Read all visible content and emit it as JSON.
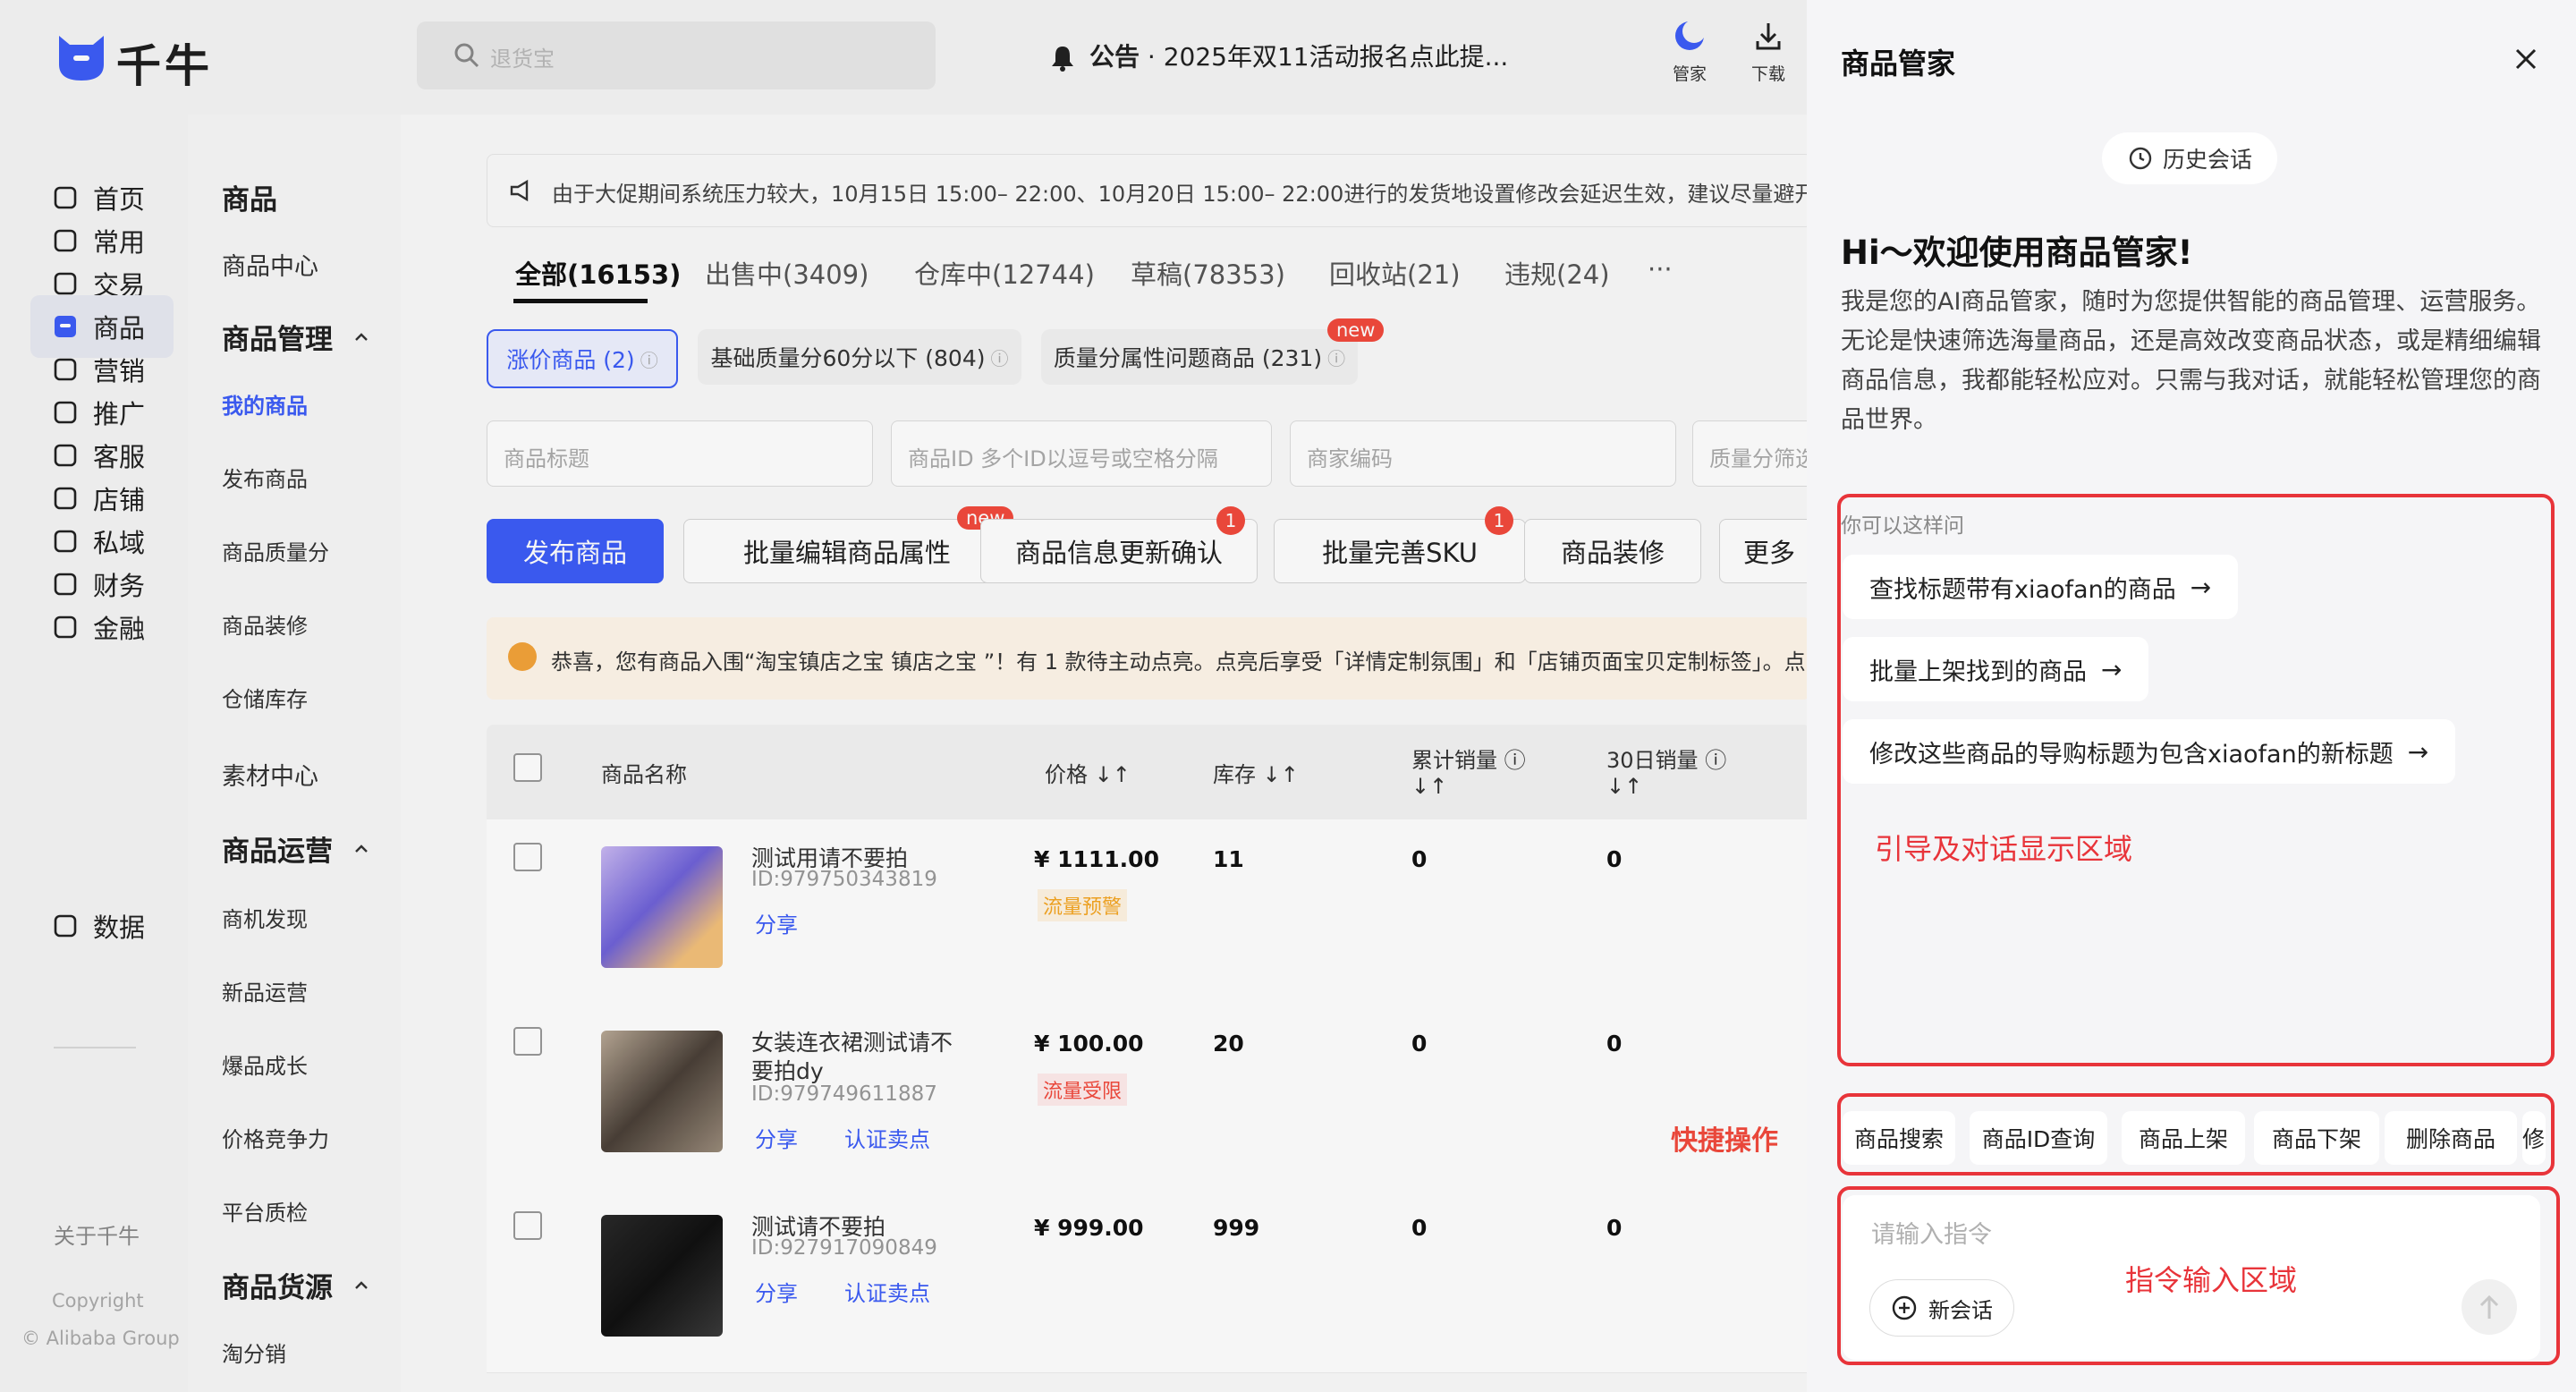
{
  "header": {
    "logo_text": "千牛",
    "search_placeholder": "退货宝",
    "notice_prefix": "公告",
    "notice_text": "2025年双11活动报名点此提...",
    "buttons": [
      {
        "label": "管家",
        "icon": "moon-assistant-icon"
      },
      {
        "label": "下载",
        "icon": "download-icon"
      }
    ]
  },
  "nav_primary": [
    {
      "label": "首页",
      "icon": "home-icon"
    },
    {
      "label": "常用",
      "icon": "common-icon"
    },
    {
      "label": "交易",
      "icon": "trade-icon"
    },
    {
      "label": "商品",
      "icon": "product-icon",
      "active": true
    },
    {
      "label": "营销",
      "icon": "marketing-icon"
    },
    {
      "label": "推广",
      "icon": "promote-icon"
    },
    {
      "label": "客服",
      "icon": "service-icon"
    },
    {
      "label": "店铺",
      "icon": "shop-icon"
    },
    {
      "label": "私域",
      "icon": "private-domain-icon"
    },
    {
      "label": "财务",
      "icon": "finance-icon"
    },
    {
      "label": "金融",
      "icon": "money-icon"
    },
    {
      "label": "数据",
      "icon": "data-icon"
    }
  ],
  "nav_footer": {
    "about": "关于千牛",
    "copyright": "Copyright",
    "company": "© Alibaba Group"
  },
  "nav_secondary": [
    {
      "label": "商品",
      "type": "header"
    },
    {
      "label": "商品中心",
      "type": "sub"
    },
    {
      "label": "商品管理",
      "type": "header",
      "expanded": true
    },
    {
      "label": "我的商品",
      "type": "item",
      "active": true
    },
    {
      "label": "发布商品",
      "type": "item"
    },
    {
      "label": "商品质量分",
      "type": "item"
    },
    {
      "label": "商品装修",
      "type": "item"
    },
    {
      "label": "仓储库存",
      "type": "item"
    },
    {
      "label": "素材中心",
      "type": "sub"
    },
    {
      "label": "商品运营",
      "type": "header",
      "expanded": true
    },
    {
      "label": "商机发现",
      "type": "item"
    },
    {
      "label": "新品运营",
      "type": "item"
    },
    {
      "label": "爆品成长",
      "type": "item"
    },
    {
      "label": "价格竞争力",
      "type": "item"
    },
    {
      "label": "平台质检",
      "type": "item"
    },
    {
      "label": "商品货源",
      "type": "header",
      "expanded": true
    },
    {
      "label": "淘分销",
      "type": "item"
    }
  ],
  "announcement": "由于大促期间系统压力较大，10月15日 15:00– 22:00、10月20日 15:00– 22:00进行的发货地设置修改会延迟生效，建议尽量避开该时",
  "tabs": [
    "全部(16153)",
    "出售中(3409)",
    "仓库中(12744)",
    "草稿(78353)",
    "回收站(21)",
    "违规(24)",
    "···"
  ],
  "filter_chips": [
    {
      "label": "涨价商品 (2)",
      "active": true
    },
    {
      "label": "基础质量分60分以下 (804)"
    },
    {
      "label": "质量分属性问题商品 (231)",
      "badge": "new"
    }
  ],
  "fields": [
    "商品标题",
    "商品ID    多个ID以逗号或空格分隔",
    "商家编码",
    "质量分筛选"
  ],
  "action_buttons": [
    {
      "label": "发布商品",
      "primary": true
    },
    {
      "label": "批量编辑商品属性",
      "badge": "new"
    },
    {
      "label": "商品信息更新确认",
      "badge": "1"
    },
    {
      "label": "批量完善SKU",
      "badge": "1"
    },
    {
      "label": "商品装修"
    },
    {
      "label": "更多"
    }
  ],
  "promo": "恭喜，您有商品入围“淘宝镇店之宝 镇店之宝 ”！有 1 款待主动点亮。点亮后享受「详情定制氛围」和「店铺页面宝贝定制标签」。点击",
  "table": {
    "headers": {
      "name": "商品名称",
      "price": "价格",
      "stock": "库存",
      "total_sales": "累计销量",
      "sales30": "30日销量"
    },
    "rows": [
      {
        "name": "测试用请不要拍",
        "name2": "",
        "id": "ID:979750343819",
        "links": [
          "分享"
        ],
        "price": "¥ 1111.00",
        "tag": "流量预警",
        "tag_color": "#f5a623",
        "stock": "11",
        "total": "0",
        "sales30": "0"
      },
      {
        "name": "女装连衣裙测试请不",
        "name2": "要拍dy",
        "id": "ID:979749611887",
        "links": [
          "分享",
          "认证卖点"
        ],
        "price": "¥ 100.00",
        "tag": "流量受限",
        "tag_color": "#f24a3d",
        "stock": "20",
        "total": "0",
        "sales30": "0"
      },
      {
        "name": "测试请不要拍",
        "name2": "",
        "id": "ID:927917090849",
        "links": [
          "分享",
          "认证卖点"
        ],
        "price": "¥ 999.00",
        "tag": "",
        "tag_color": "",
        "stock": "999",
        "total": "0",
        "sales30": "0"
      }
    ]
  },
  "annotation_quick": "快捷操作",
  "panel": {
    "title": "商品管家",
    "history": "历史会话",
    "greeting": "Hi～欢迎使用商品管家!",
    "intro": "我是您的AI商品管家，随时为您提供智能的商品管理、运营服务。无论是快速筛选海量商品，还是高效改变商品状态，或是精细编辑商品信息，我都能轻松应对。只需与我对话，就能轻松管理您的商品世界。",
    "ask_label": "你可以这样问",
    "suggestions": [
      "查找标题带有xiaofan的商品",
      "批量上架找到的商品",
      "修改这些商品的导购标题为包含xiaofan的新标题"
    ],
    "guide_label": "引导及对话显示区域",
    "quick_actions": [
      "商品搜索",
      "商品ID查询",
      "商品上架",
      "商品下架",
      "删除商品",
      "修"
    ],
    "input_placeholder": "请输入指令",
    "input_label": "指令输入区域",
    "new_chat": "新会话"
  }
}
